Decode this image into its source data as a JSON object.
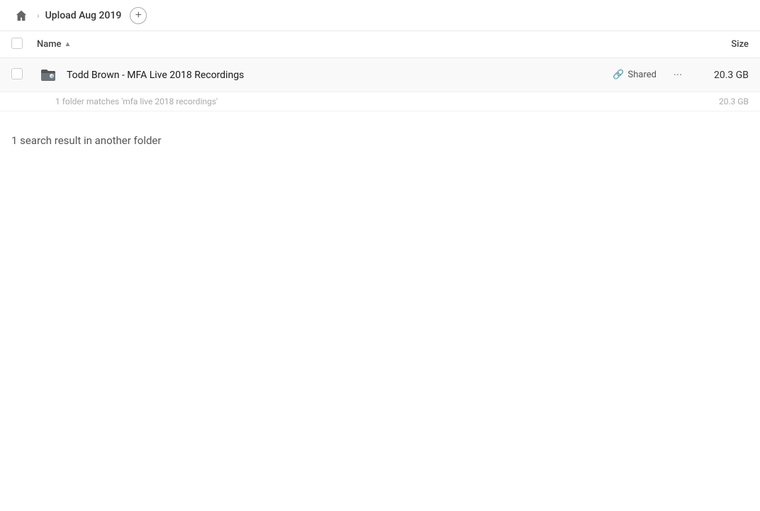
{
  "header": {
    "home_icon": "home",
    "breadcrumb": "Upload Aug 2019",
    "add_button": "+"
  },
  "table": {
    "col_name_label": "Name",
    "col_size_label": "Size",
    "sort_indicator": "▲"
  },
  "file_row": {
    "name": "Todd Brown - MFA Live 2018 Recordings",
    "shared_label": "Shared",
    "size": "20.3 GB",
    "more_icon": "···"
  },
  "match_info": {
    "text": "1 folder matches 'mfa live 2018 recordings'",
    "size": "20.3 GB"
  },
  "other_results": {
    "text": "1 search result in another folder"
  }
}
